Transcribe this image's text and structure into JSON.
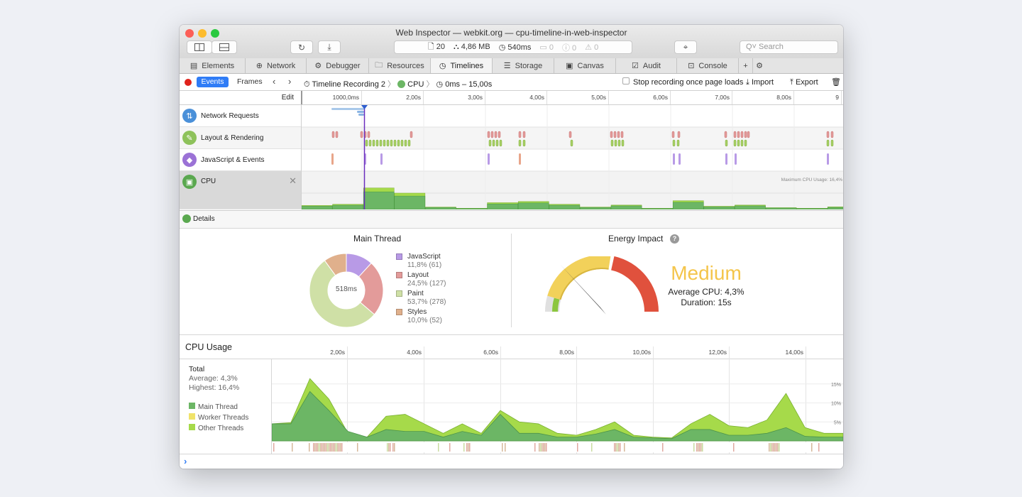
{
  "window": {
    "title": "Web Inspector — webkit.org — cpu-timeline-in-web-inspector"
  },
  "status": {
    "resources": "20",
    "size": "4,86 MB",
    "time": "540ms",
    "logs": "0",
    "errors": "0",
    "warnings": "0"
  },
  "search": {
    "placeholder": "Search"
  },
  "tabs": [
    {
      "label": "Elements",
      "icon": "elements-icon"
    },
    {
      "label": "Network",
      "icon": "network-icon"
    },
    {
      "label": "Debugger",
      "icon": "debugger-icon"
    },
    {
      "label": "Resources",
      "icon": "resources-icon"
    },
    {
      "label": "Timelines",
      "icon": "timelines-icon",
      "active": true
    },
    {
      "label": "Storage",
      "icon": "storage-icon"
    },
    {
      "label": "Canvas",
      "icon": "canvas-icon"
    },
    {
      "label": "Audit",
      "icon": "audit-icon"
    },
    {
      "label": "Console",
      "icon": "console-icon"
    }
  ],
  "toolbar": {
    "events": "Events",
    "frames": "Frames",
    "recording": "Timeline Recording 2",
    "crumb": "CPU",
    "range": "0ms – 15,00s",
    "stop_checkbox": "Stop recording once page loads",
    "import": "Import",
    "export": "Export"
  },
  "overview": {
    "edit": "Edit",
    "ticks": [
      "1000,0ms",
      "2,00s",
      "3,00s",
      "4,00s",
      "5,00s",
      "6,00s",
      "7,00s",
      "8,00s",
      "9"
    ],
    "rows": [
      "Network Requests",
      "Layout & Rendering",
      "JavaScript & Events",
      "CPU"
    ],
    "max_cpu": "Maximum CPU Usage: 16,4%",
    "cpu_bars": [
      2.0,
      2.6,
      10.8,
      8.2,
      1.2,
      0.6,
      3.4,
      4.0,
      2.6,
      1.2,
      2.2,
      0.6,
      4.4,
      1.6,
      2.2,
      0.9,
      0.6,
      1.3
    ]
  },
  "details": {
    "label": "Details"
  },
  "main_thread": {
    "title": "Main Thread",
    "center": "518ms",
    "items": [
      {
        "label": "JavaScript",
        "sub": "11,8% (61)",
        "color": "#b89ae6",
        "value": 11.8
      },
      {
        "label": "Layout",
        "sub": "24,5% (127)",
        "color": "#e39b9a",
        "value": 24.5
      },
      {
        "label": "Paint",
        "sub": "53,7% (278)",
        "color": "#cfe0a6",
        "value": 53.7
      },
      {
        "label": "Styles",
        "sub": "10,0% (52)",
        "color": "#e0b08c",
        "value": 10.0
      }
    ]
  },
  "energy": {
    "title": "Energy Impact",
    "level": "Medium",
    "avg": "Average CPU: 4,3%",
    "duration": "Duration: 15s",
    "needle_fraction": 0.27
  },
  "cpu_usage": {
    "title": "CPU Usage",
    "total": "Total",
    "average": "Average: 4,3%",
    "highest": "Highest: 16,4%",
    "legend": [
      {
        "label": "Main Thread",
        "color": "#6cb665"
      },
      {
        "label": "Worker Threads",
        "color": "#f0e36a"
      },
      {
        "label": "Other Threads",
        "color": "#a6da4a"
      }
    ],
    "ticks": [
      "2,00s",
      "4,00s",
      "6,00s",
      "8,00s",
      "10,00s",
      "12,00s",
      "14,00s"
    ],
    "y_ticks": [
      "15%",
      "10%",
      "5%"
    ]
  },
  "chart_data": {
    "type": "area",
    "title": "CPU Usage",
    "xlabel": "",
    "ylabel": "",
    "xlim": [
      0,
      15
    ],
    "ylim": [
      0,
      20
    ],
    "x": [
      0,
      0.5,
      1,
      1.5,
      2,
      2.5,
      3,
      3.5,
      4,
      4.5,
      5,
      5.5,
      6,
      6.5,
      7,
      7.5,
      8,
      8.5,
      9,
      9.5,
      10,
      10.5,
      11,
      11.5,
      12,
      12.5,
      13,
      13.5,
      14,
      14.5,
      15
    ],
    "series": [
      {
        "name": "Main Thread",
        "values": [
          4.5,
          4.5,
          13.0,
          8.0,
          2.5,
          1.0,
          3.0,
          2.5,
          2.5,
          1.0,
          2.5,
          1.5,
          7.0,
          2.0,
          2.0,
          1.0,
          1.0,
          1.8,
          3.0,
          1.0,
          0.8,
          0.6,
          3.0,
          3.0,
          1.5,
          1.5,
          2.0,
          3.5,
          1.2,
          1.0,
          1.0
        ]
      },
      {
        "name": "Other Threads",
        "values": [
          4.5,
          4.8,
          16.4,
          11.0,
          2.0,
          1.0,
          6.5,
          7.0,
          4.5,
          2.0,
          4.5,
          2.0,
          8.0,
          5.0,
          4.5,
          2.0,
          1.5,
          3.0,
          5.0,
          1.5,
          1.0,
          0.8,
          4.5,
          7.0,
          4.0,
          3.5,
          5.5,
          12.5,
          3.5,
          2.0,
          2.0
        ]
      }
    ]
  }
}
